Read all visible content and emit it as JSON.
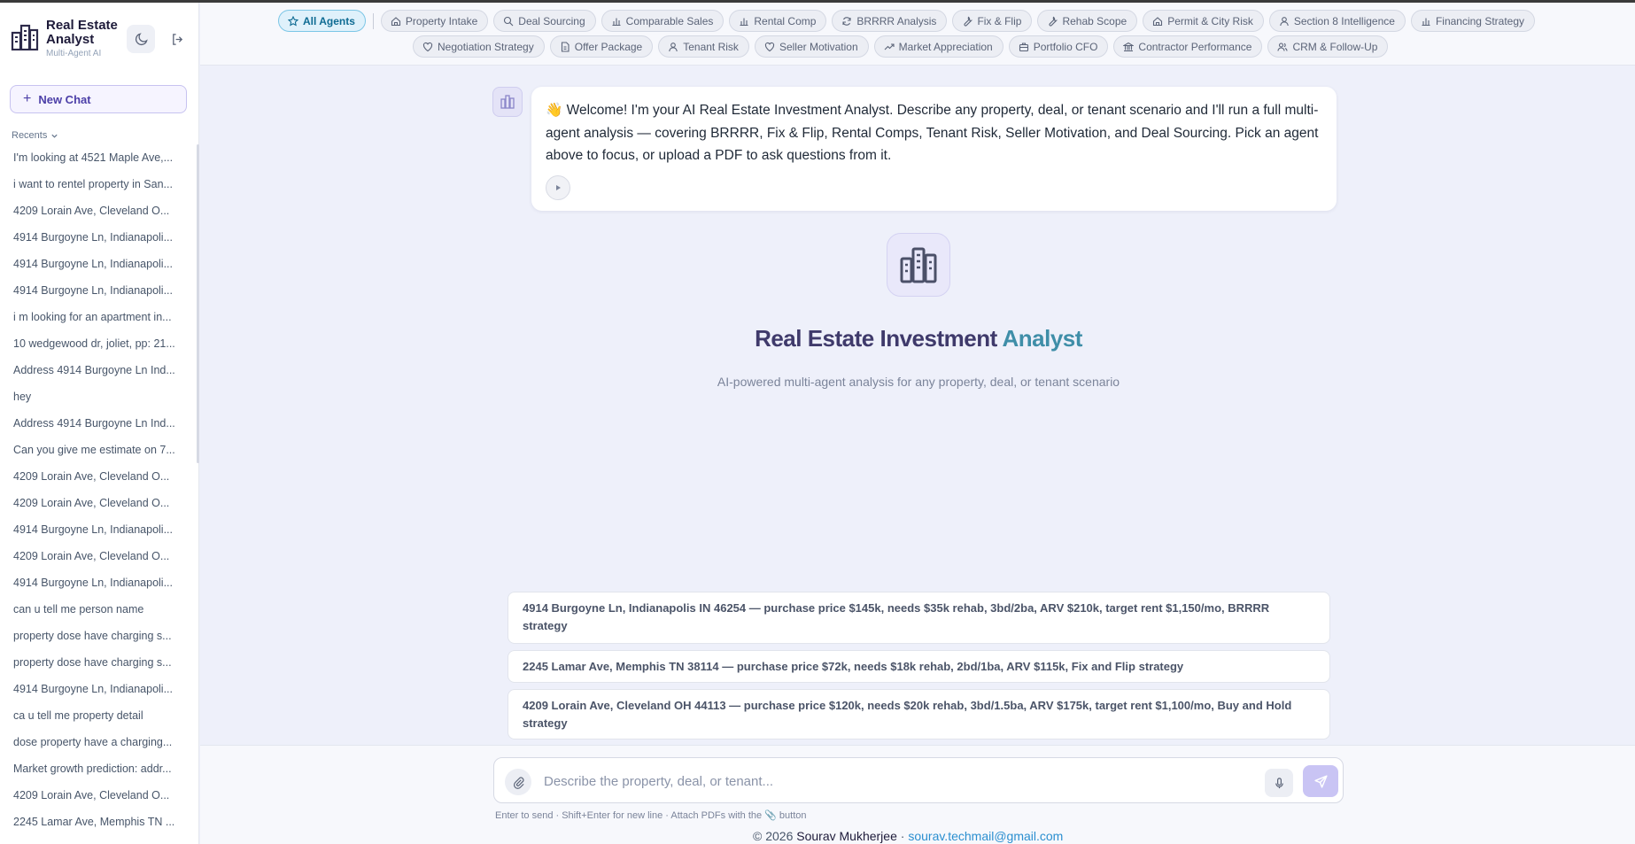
{
  "brand": {
    "title": "Real Estate Analyst",
    "subtitle": "Multi-Agent AI"
  },
  "sidebar": {
    "new_chat": "New Chat",
    "recents_label": "Recents",
    "recents": [
      "I'm looking at 4521 Maple Ave,...",
      "i want to rentel property in San...",
      "4209 Lorain Ave, Cleveland O...",
      "4914 Burgoyne Ln, Indianapoli...",
      "4914 Burgoyne Ln, Indianapoli...",
      "4914 Burgoyne Ln, Indianapoli...",
      "i m looking for an apartment in...",
      "10 wedgewood dr, joliet, pp: 21...",
      "Address 4914 Burgoyne Ln Ind...",
      "hey",
      "Address 4914 Burgoyne Ln Ind...",
      "Can you give me estimate on 7...",
      "4209 Lorain Ave, Cleveland O...",
      "4209 Lorain Ave, Cleveland O...",
      "4914 Burgoyne Ln, Indianapoli...",
      "4209 Lorain Ave, Cleveland O...",
      "4914 Burgoyne Ln, Indianapoli...",
      "can u tell me person name",
      "property dose have charging s...",
      "property dose have charging s...",
      "4914 Burgoyne Ln, Indianapoli...",
      "ca u tell me property detail",
      "dose property have a charging...",
      "Market growth prediction: addr...",
      "4209 Lorain Ave, Cleveland O...",
      "2245 Lamar Ave, Memphis TN ..."
    ]
  },
  "agents": {
    "row1": [
      {
        "label": "All Agents",
        "icon": "star-icon",
        "active": true
      },
      {
        "label": "Property Intake",
        "icon": "home-icon"
      },
      {
        "label": "Deal Sourcing",
        "icon": "search-icon"
      },
      {
        "label": "Comparable Sales",
        "icon": "bar-chart-icon"
      },
      {
        "label": "Rental Comp",
        "icon": "bar-chart-icon"
      },
      {
        "label": "BRRRR Analysis",
        "icon": "refresh-icon"
      },
      {
        "label": "Fix & Flip",
        "icon": "wrench-icon"
      },
      {
        "label": "Rehab Scope",
        "icon": "wrench-icon"
      },
      {
        "label": "Permit & City Risk",
        "icon": "home-icon"
      },
      {
        "label": "Section 8 Intelligence",
        "icon": "user-icon"
      },
      {
        "label": "Financing Strategy",
        "icon": "bar-chart-icon"
      }
    ],
    "row2": [
      {
        "label": "Negotiation Strategy",
        "icon": "heart-icon"
      },
      {
        "label": "Offer Package",
        "icon": "document-icon"
      },
      {
        "label": "Tenant Risk",
        "icon": "user-icon"
      },
      {
        "label": "Seller Motivation",
        "icon": "heart-icon"
      },
      {
        "label": "Market Appreciation",
        "icon": "trend-up-icon"
      },
      {
        "label": "Portfolio CFO",
        "icon": "briefcase-icon"
      },
      {
        "label": "Contractor Performance",
        "icon": "bank-icon"
      },
      {
        "label": "CRM & Follow-Up",
        "icon": "users-icon"
      }
    ]
  },
  "welcome": {
    "emoji": "👋",
    "text": "Welcome! I'm your AI Real Estate Investment Analyst. Describe any property, deal, or tenant scenario and I'll run a full multi-agent analysis — covering BRRRR, Fix & Flip, Rental Comps, Tenant Risk, Seller Motivation, and Deal Sourcing. Pick an agent above to focus, or upload a PDF to ask questions from it."
  },
  "hero": {
    "title_a": "Real Estate ",
    "title_b": "Investment ",
    "title_c": "Analyst",
    "subtitle": "AI-powered multi-agent analysis for any property, deal, or tenant scenario"
  },
  "suggestions": [
    "4914 Burgoyne Ln, Indianapolis IN 46254 — purchase price $145k, needs $35k rehab, 3bd/2ba, ARV $210k, target rent $1,150/mo, BRRRR strategy",
    "2245 Lamar Ave, Memphis TN 38114 — purchase price $72k, needs $18k rehab, 2bd/1ba, ARV $115k, Fix and Flip strategy",
    "4209 Lorain Ave, Cleveland OH 44113 — purchase price $120k, needs $20k rehab, 3bd/1.5ba, ARV $175k, target rent $1,100/mo, Buy and Hold strategy"
  ],
  "composer": {
    "placeholder": "Describe the property, deal, or tenant...",
    "hint": "Enter to send · Shift+Enter for new line · Attach PDFs with the 📎 button"
  },
  "footer": {
    "copyright": "© 2026 ",
    "name": "Sourav Mukherjee",
    "sep": " · ",
    "email": "sourav.techmail@gmail.com"
  }
}
